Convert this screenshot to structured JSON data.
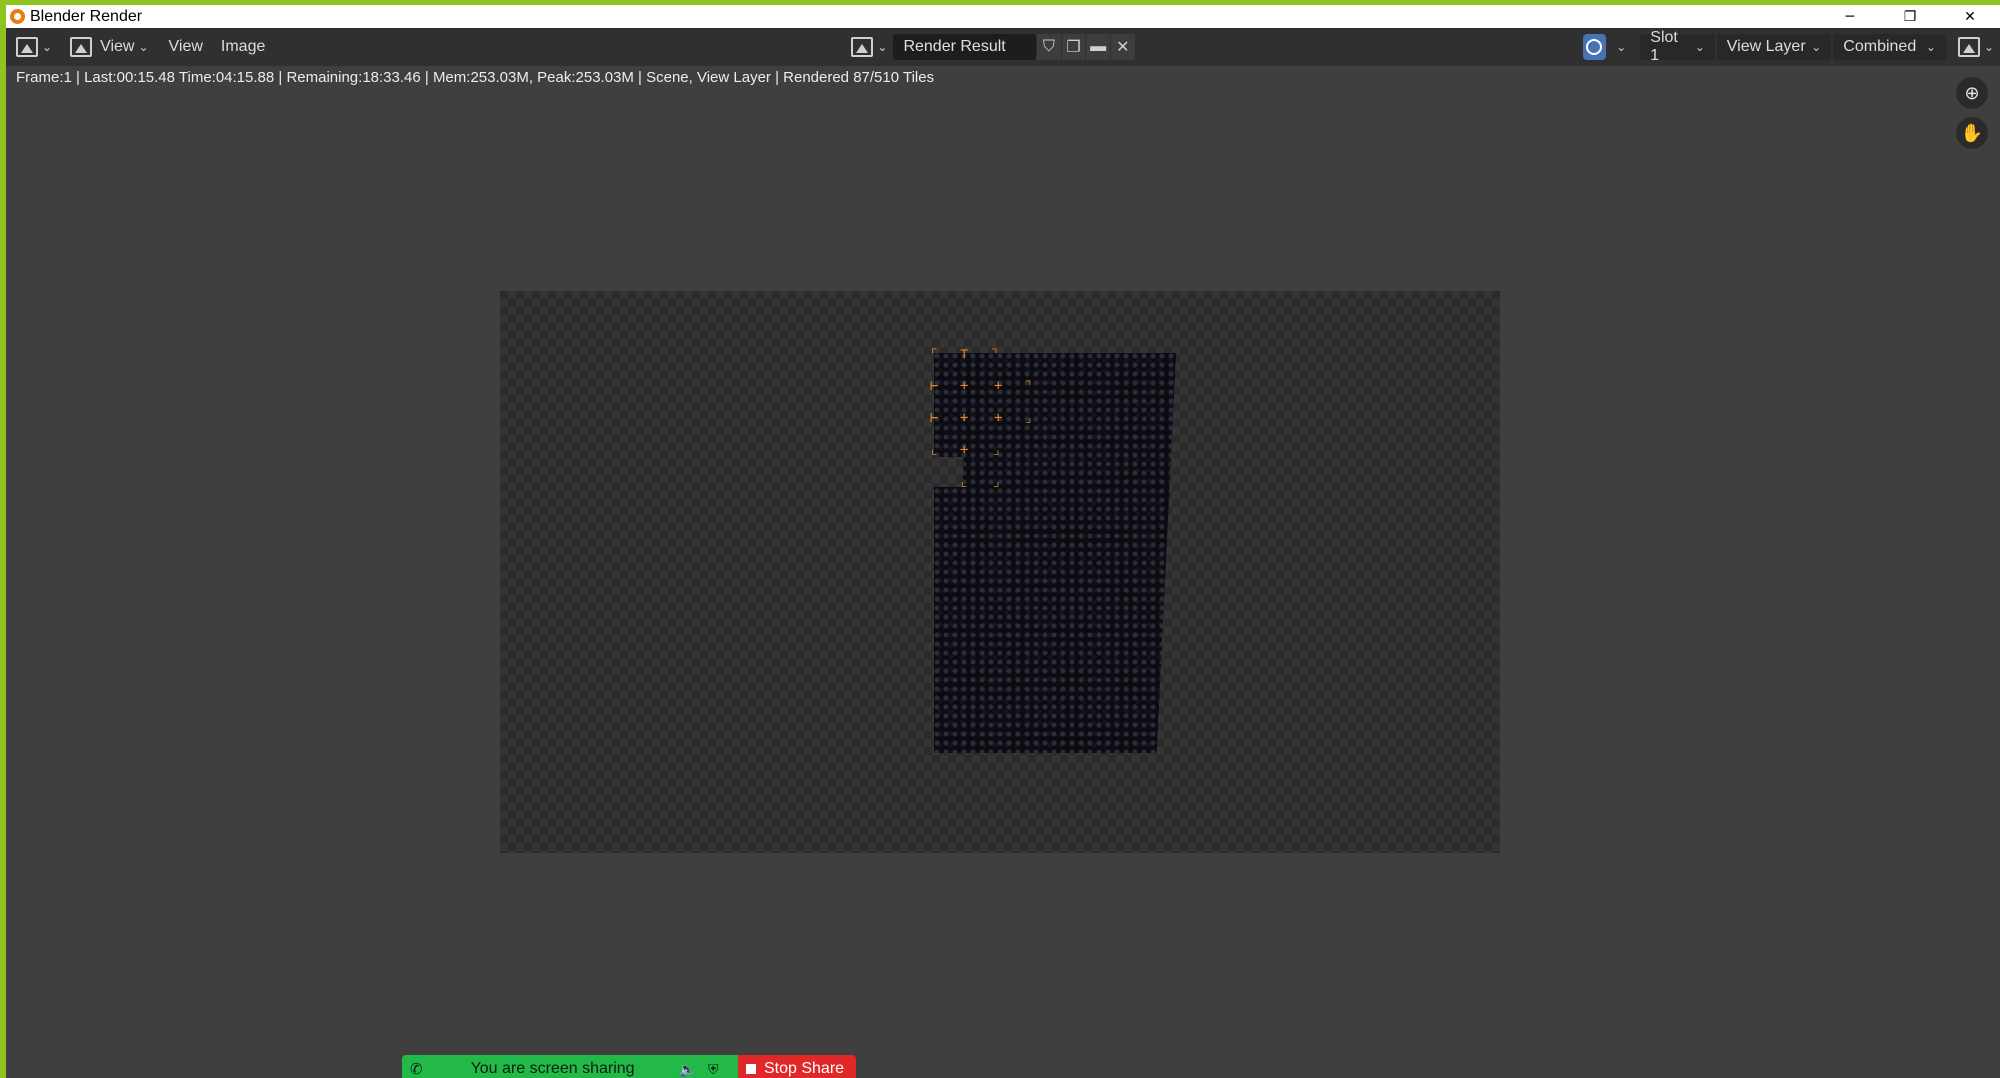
{
  "window": {
    "title": "Blender Render",
    "controls": {
      "minimize": "─",
      "restore": "❐",
      "close": "✕"
    }
  },
  "header": {
    "editor_type_icon": "image-editor-icon",
    "view_menu_1": "View",
    "view_menu_2": "View",
    "image_menu": "Image",
    "image_selector": "Render Result",
    "slot": "Slot 1",
    "view_layer": "View Layer",
    "pass": "Combined"
  },
  "status": {
    "info": "Frame:1 | Last:00:15.48 Time:04:15.88 | Remaining:18:33.46 | Mem:253.03M, Peak:253.03M | Scene, View Layer | Rendered 87/510 Tiles"
  },
  "sharing": {
    "message": "You are screen sharing",
    "stop_label": "Stop Share"
  },
  "colors": {
    "accent_green": "#8fc31f",
    "tile_orange": "#e8891c",
    "share_green": "#22b948",
    "stop_red": "#e02828",
    "overlay_blue": "#4772b3"
  }
}
